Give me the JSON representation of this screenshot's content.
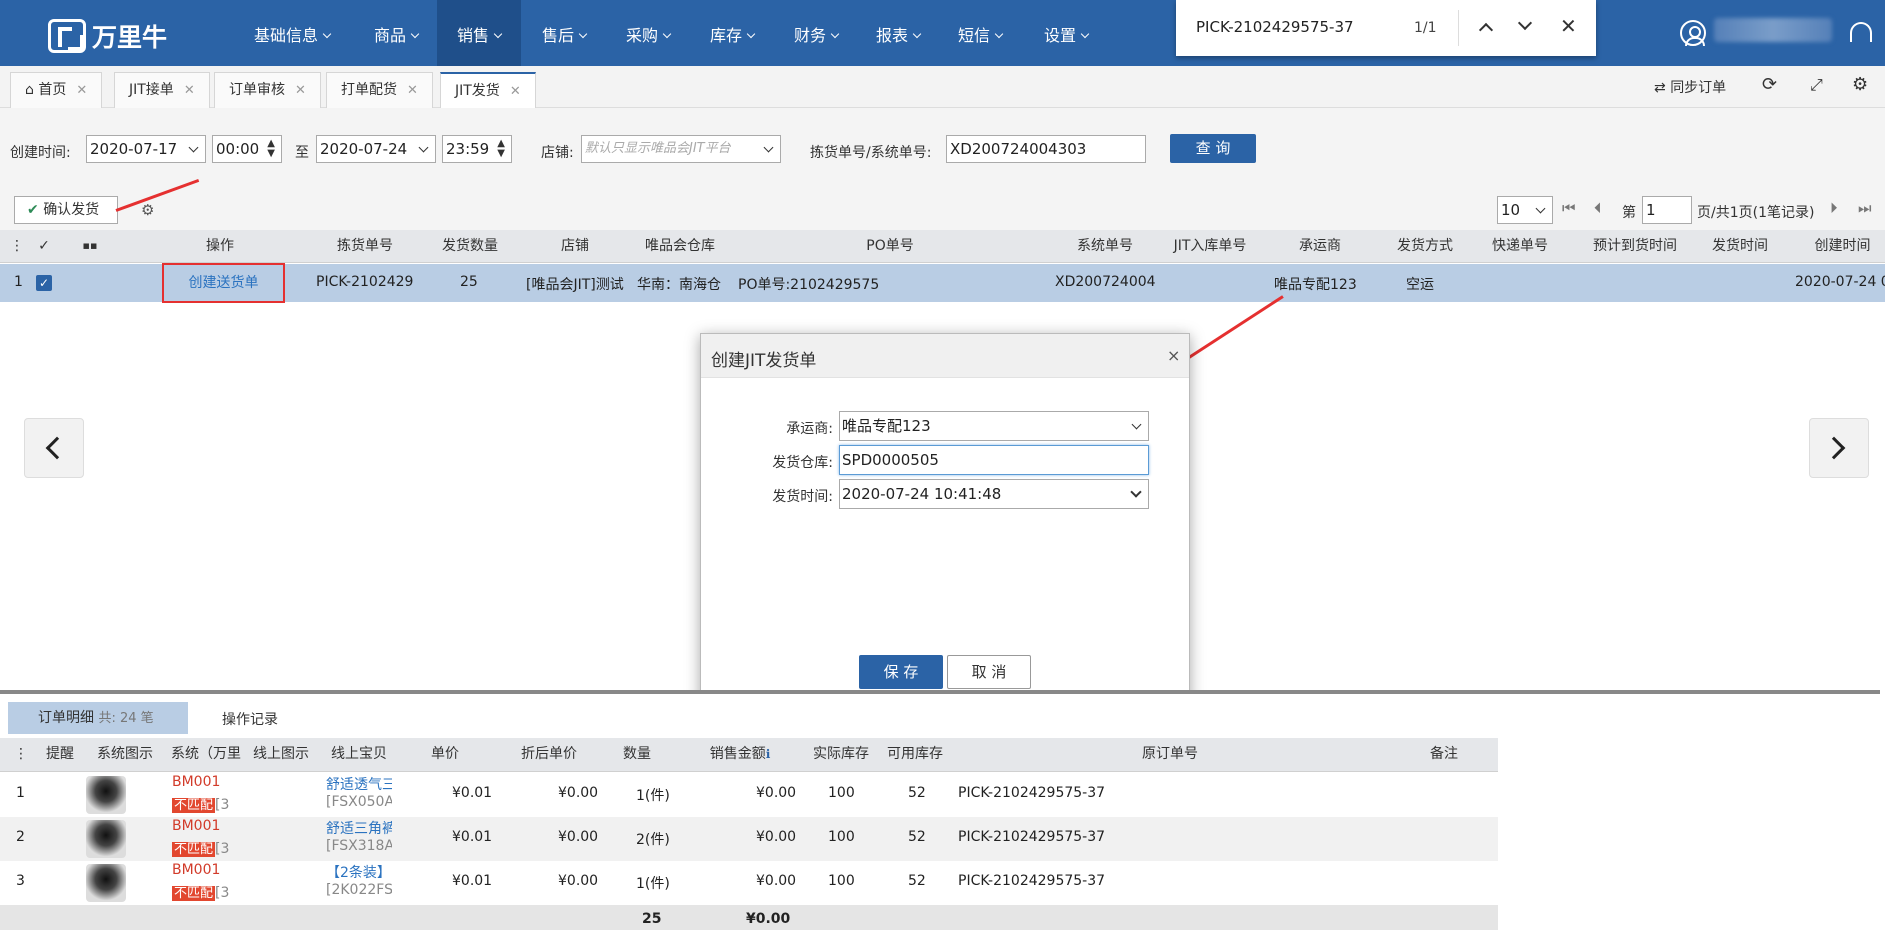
{
  "app": {
    "logo_text": "万里牛"
  },
  "nav": [
    {
      "label": "基础信息"
    },
    {
      "label": "商品"
    },
    {
      "label": "销售"
    },
    {
      "label": "售后"
    },
    {
      "label": "采购"
    },
    {
      "label": "库存"
    },
    {
      "label": "财务"
    },
    {
      "label": "报表"
    },
    {
      "label": "短信"
    },
    {
      "label": "设置"
    }
  ],
  "find": {
    "query": "PICK-2102429575-37",
    "count": "1/1"
  },
  "tabs": [
    {
      "label": "首页"
    },
    {
      "label": "JIT接单"
    },
    {
      "label": "订单审核"
    },
    {
      "label": "打单配货"
    },
    {
      "label": "JIT发货"
    }
  ],
  "toolbar_right": {
    "sync": "同步订单"
  },
  "filter": {
    "created_label": "创建时间:",
    "date_from": "2020-07-17",
    "time_from": "00:00",
    "to": "至",
    "date_to": "2020-07-24",
    "time_to": "23:59",
    "shop_label": "店铺:",
    "shop_placeholder": "默认只显示唯品会JIT平台",
    "pick_label": "拣货单号/系统单号:",
    "pick_value": "XD200724004303",
    "query_btn": "查 询"
  },
  "actions": {
    "confirm_ship": "确认发货"
  },
  "pager": {
    "size": "10",
    "di": "第",
    "page": "1",
    "info": "页/共1页(1笔记录)"
  },
  "grid": {
    "headers": [
      "操作",
      "拣货单号",
      "发货数量",
      "店铺",
      "唯品会仓库",
      "PO单号",
      "系统单号",
      "JIT入库单号",
      "承运商",
      "发货方式",
      "快递单号",
      "预计到货时间",
      "发货时间",
      "创建时间"
    ],
    "row": {
      "idx": "1",
      "op": "创建送货单",
      "pick": "PICK-2102429",
      "qty": "25",
      "shop": "[唯品会JIT]测试",
      "wh": "华南：南海仓",
      "po": "PO单号:2102429575",
      "sys": "XD200724004",
      "carrier": "唯品专配123",
      "ship_mode": "空运",
      "created": "2020-07-24 0"
    }
  },
  "modal": {
    "title": "创建JIT发货单",
    "carrier_label": "承运商:",
    "carrier": "唯品专配123",
    "wh_label": "发货仓库:",
    "wh": "SPD0000505",
    "time_label": "发货时间:",
    "time": "2020-07-24 10:41:48",
    "save": "保 存",
    "cancel": "取 消"
  },
  "bottom": {
    "tab1": "订单明细",
    "tab1_count": "共: 24 笔",
    "tab2": "操作记录",
    "headers": [
      "提醒",
      "系统图示",
      "系统（万里",
      "线上图示",
      "线上宝贝信",
      "单价",
      "折后单价",
      "数量",
      "销售金额",
      "实际库存",
      "可用库存",
      "原订单号",
      "备注"
    ],
    "rows": [
      {
        "idx": "1",
        "code": "BM001",
        "tag": "不匹配",
        "tag_extra": "[3",
        "title": "舒适透气三",
        "sub": "[FSX050A",
        "price": "¥0.01",
        "dprice": "¥0.00",
        "qty": "1(件)",
        "amount": "¥0.00",
        "stock": "100",
        "avail": "52",
        "orig": "PICK-2102429575-37"
      },
      {
        "idx": "2",
        "code": "BM001",
        "tag": "不匹配",
        "tag_extra": "[3",
        "title": "舒适三角裤",
        "sub": "[FSX318A",
        "price": "¥0.01",
        "dprice": "¥0.00",
        "qty": "2(件)",
        "amount": "¥0.00",
        "stock": "100",
        "avail": "52",
        "orig": "PICK-2102429575-37"
      },
      {
        "idx": "3",
        "code": "BM001",
        "tag": "不匹配",
        "tag_extra": "[3",
        "title": "【2条装】",
        "sub": "[2K022FS",
        "price": "¥0.01",
        "dprice": "¥0.00",
        "qty": "1(件)",
        "amount": "¥0.00",
        "stock": "100",
        "avail": "52",
        "orig": "PICK-2102429575-37"
      }
    ],
    "total_qty": "25",
    "total_amount": "¥0.00"
  }
}
